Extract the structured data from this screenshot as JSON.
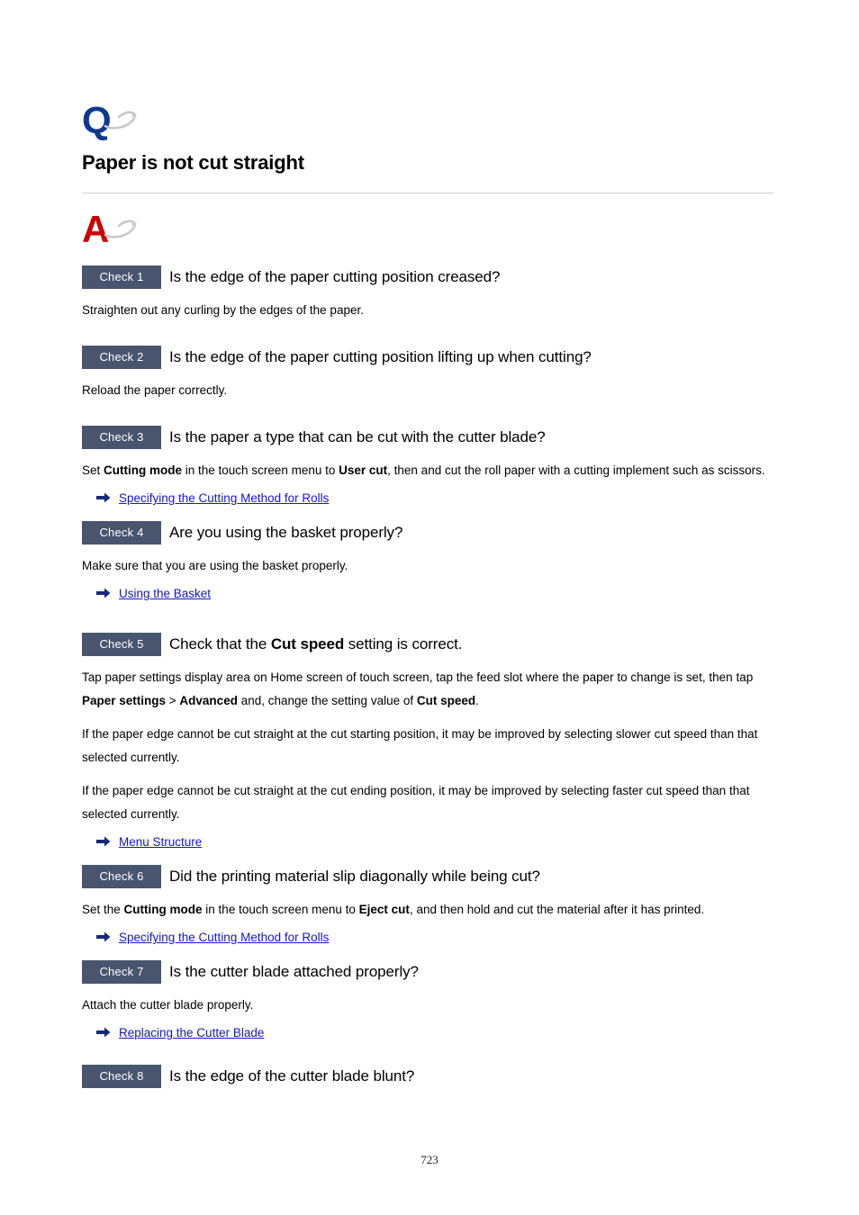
{
  "document": {
    "q_mark_label": "Q",
    "a_mark_label": "A",
    "title": "Paper is not cut straight",
    "page_number": "723"
  },
  "colors": {
    "badge_background": "#49546f",
    "badge_text": "#ffffff",
    "q_mark": "#11388f",
    "a_mark": "#cc0000",
    "link": "#1414cc",
    "rule": "#cfcfcf",
    "swoosh": "#c8c8c8"
  },
  "checks": [
    {
      "badge": "Check 1",
      "title": "Is the edge of the paper cutting position creased?",
      "paragraphs": [
        "Straighten out any curling by the edges of the paper."
      ],
      "links": []
    },
    {
      "badge": "Check 2",
      "title": "Is the edge of the paper cutting position lifting up when cutting?",
      "paragraphs": [
        "Reload the paper correctly."
      ],
      "links": []
    },
    {
      "badge": "Check 3",
      "title": "Is the paper a type that can be cut with the cutter blade?",
      "paragraphs": [
        "Set Cutting mode in the touch screen menu to User cut, then and cut the roll paper with a cutting implement such as scissors."
      ],
      "paragraph_parts": [
        "Set ",
        "Cutting mode",
        " in the touch screen menu to ",
        "User cut",
        ", then and cut the roll paper with a cutting implement such as scissors."
      ],
      "links": [
        "Specifying the Cutting Method for Rolls"
      ]
    },
    {
      "badge": "Check 4",
      "title": "Are you using the basket properly?",
      "paragraphs": [
        "Make sure that you are using the basket properly."
      ],
      "links": [
        "Using the Basket"
      ]
    },
    {
      "badge": "Check 5",
      "title_parts": [
        "Check that the ",
        "Cut speed",
        " setting is correct."
      ],
      "title": "Check that the Cut speed setting is correct.",
      "paragraph_parts": [
        "Tap paper settings display area on Home screen of touch screen, tap the feed slot where the paper to change is set, then tap ",
        "Paper settings",
        " > ",
        "Advanced",
        " and, change the setting value of ",
        "Cut speed",
        "."
      ],
      "paragraphs": [
        "If the paper edge cannot be cut straight at the cut starting position, it may be improved by selecting slower cut speed than that selected currently.",
        "If the paper edge cannot be cut straight at the cut ending position, it may be improved by selecting faster cut speed than that selected currently."
      ],
      "links": [
        "Menu Structure"
      ]
    },
    {
      "badge": "Check 6",
      "title": "Did the printing material slip diagonally while being cut?",
      "paragraph_parts": [
        "Set the ",
        "Cutting mode",
        " in the touch screen menu to ",
        "Eject cut",
        ", and then hold and cut the material after it has printed."
      ],
      "links": [
        "Specifying the Cutting Method for Rolls"
      ]
    },
    {
      "badge": "Check 7",
      "title": "Is the cutter blade attached properly?",
      "paragraphs": [
        "Attach the cutter blade properly."
      ],
      "links": [
        "Replacing the Cutter Blade"
      ]
    },
    {
      "badge": "Check 8",
      "title": "Is the edge of the cutter blade blunt?",
      "paragraphs": [],
      "links": []
    }
  ]
}
